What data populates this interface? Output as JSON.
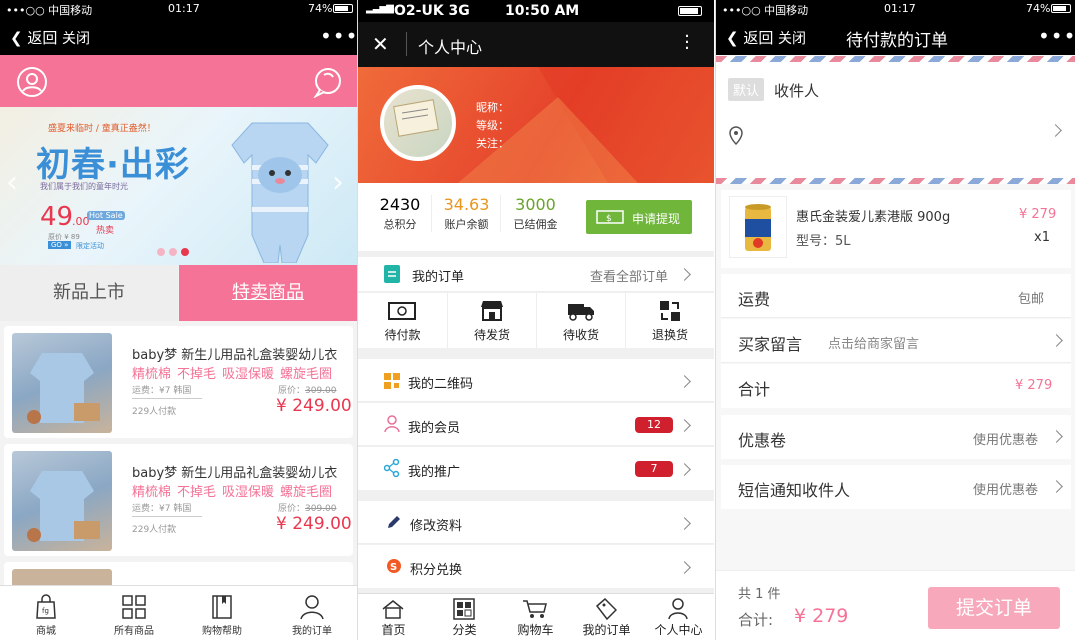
{
  "screens": {
    "shop": {
      "status": {
        "carrier": "•••○○ 中国移动",
        "time": "01:17",
        "battery": "74%"
      },
      "nav": {
        "back": "返回",
        "close": "关闭",
        "more": "•••"
      },
      "banner": {
        "headline": "初春·出彩",
        "tagline": "盛夏来临时 / 童真正盎然！",
        "sub": "我们属于我们的童年时光",
        "price": "49",
        "price_cents": ".00",
        "tag": "Hot Sale",
        "hot": "热卖",
        "old_price": "原价 ¥ 89",
        "go": "GO »",
        "pre": "限定活动"
      },
      "tabs": {
        "new": "新品上市",
        "special": "特卖商品"
      },
      "products": [
        {
          "title": "baby梦 新生儿用品礼盒装婴幼儿衣",
          "tags": [
            "精梳棉",
            "不掉毛",
            "吸湿保暖",
            "螺旋毛圈"
          ],
          "ship": "运费：¥7   韩国",
          "orig_label": "原价：",
          "orig": "309.00",
          "price": "¥ 249.00",
          "paid": "229人付款"
        },
        {
          "title": "baby梦 新生儿用品礼盒装婴幼儿衣",
          "tags": [
            "精梳棉",
            "不掉毛",
            "吸湿保暖",
            "螺旋毛圈"
          ],
          "ship": "运费：¥7   韩国",
          "orig_label": "原价：",
          "orig": "309.00",
          "price": "¥ 249.00",
          "paid": "229人付款"
        }
      ],
      "bottom_nav": [
        "商城",
        "所有商品",
        "购物帮助",
        "我的订单"
      ]
    },
    "profile": {
      "status": {
        "carrier": "O2-UK  3G",
        "time": "10:50 AM"
      },
      "nav": {
        "title": "个人中心"
      },
      "info": {
        "nickname": "昵称：",
        "level": "等级：",
        "follow": "关注："
      },
      "stats": [
        {
          "value": "2430",
          "label": "总积分",
          "color": "#333333"
        },
        {
          "value": "34.63",
          "label": "账户余额",
          "color": "#e8961e"
        },
        {
          "value": "3000",
          "label": "已结佣金",
          "color": "#6aa32c"
        }
      ],
      "withdraw": "申请提现",
      "orders": {
        "label": "我的订单",
        "all": "查看全部订单",
        "items": [
          "待付款",
          "待发货",
          "待收货",
          "退换货"
        ]
      },
      "menu1": [
        {
          "label": "我的二维码",
          "badge": ""
        },
        {
          "label": "我的会员",
          "badge": "12"
        },
        {
          "label": "我的推广",
          "badge": "7"
        }
      ],
      "menu2": [
        {
          "label": "修改资料"
        },
        {
          "label": "积分兑换"
        }
      ],
      "bottom_nav": [
        "首页",
        "分类",
        "购物车",
        "我的订单",
        "个人中心"
      ]
    },
    "checkout": {
      "status": {
        "carrier": "•••○○ 中国移动",
        "time": "01:17",
        "battery": "74%"
      },
      "nav": {
        "back": "返回",
        "close": "关闭",
        "title": "待付款的订单",
        "more": "•••"
      },
      "address": {
        "default_tag": "默认",
        "recipient": "收件人"
      },
      "item": {
        "name": "惠氏金装爱儿素港版 900g",
        "model": "型号：5L",
        "price": "¥ 279",
        "qty": "x1"
      },
      "rows": {
        "shipping": "运费",
        "shipping_val": "包邮",
        "message": "买家留言",
        "message_ph": "点击给商家留言",
        "total": "合计",
        "total_val": "¥ 279",
        "coupon": "优惠卷",
        "coupon_val": "使用优惠卷",
        "sms": "短信通知收件人",
        "sms_val": "使用优惠卷"
      },
      "footer": {
        "count": "共 1 件",
        "total_label": "合计:",
        "total": "¥ 279",
        "submit": "提交订单"
      }
    }
  }
}
